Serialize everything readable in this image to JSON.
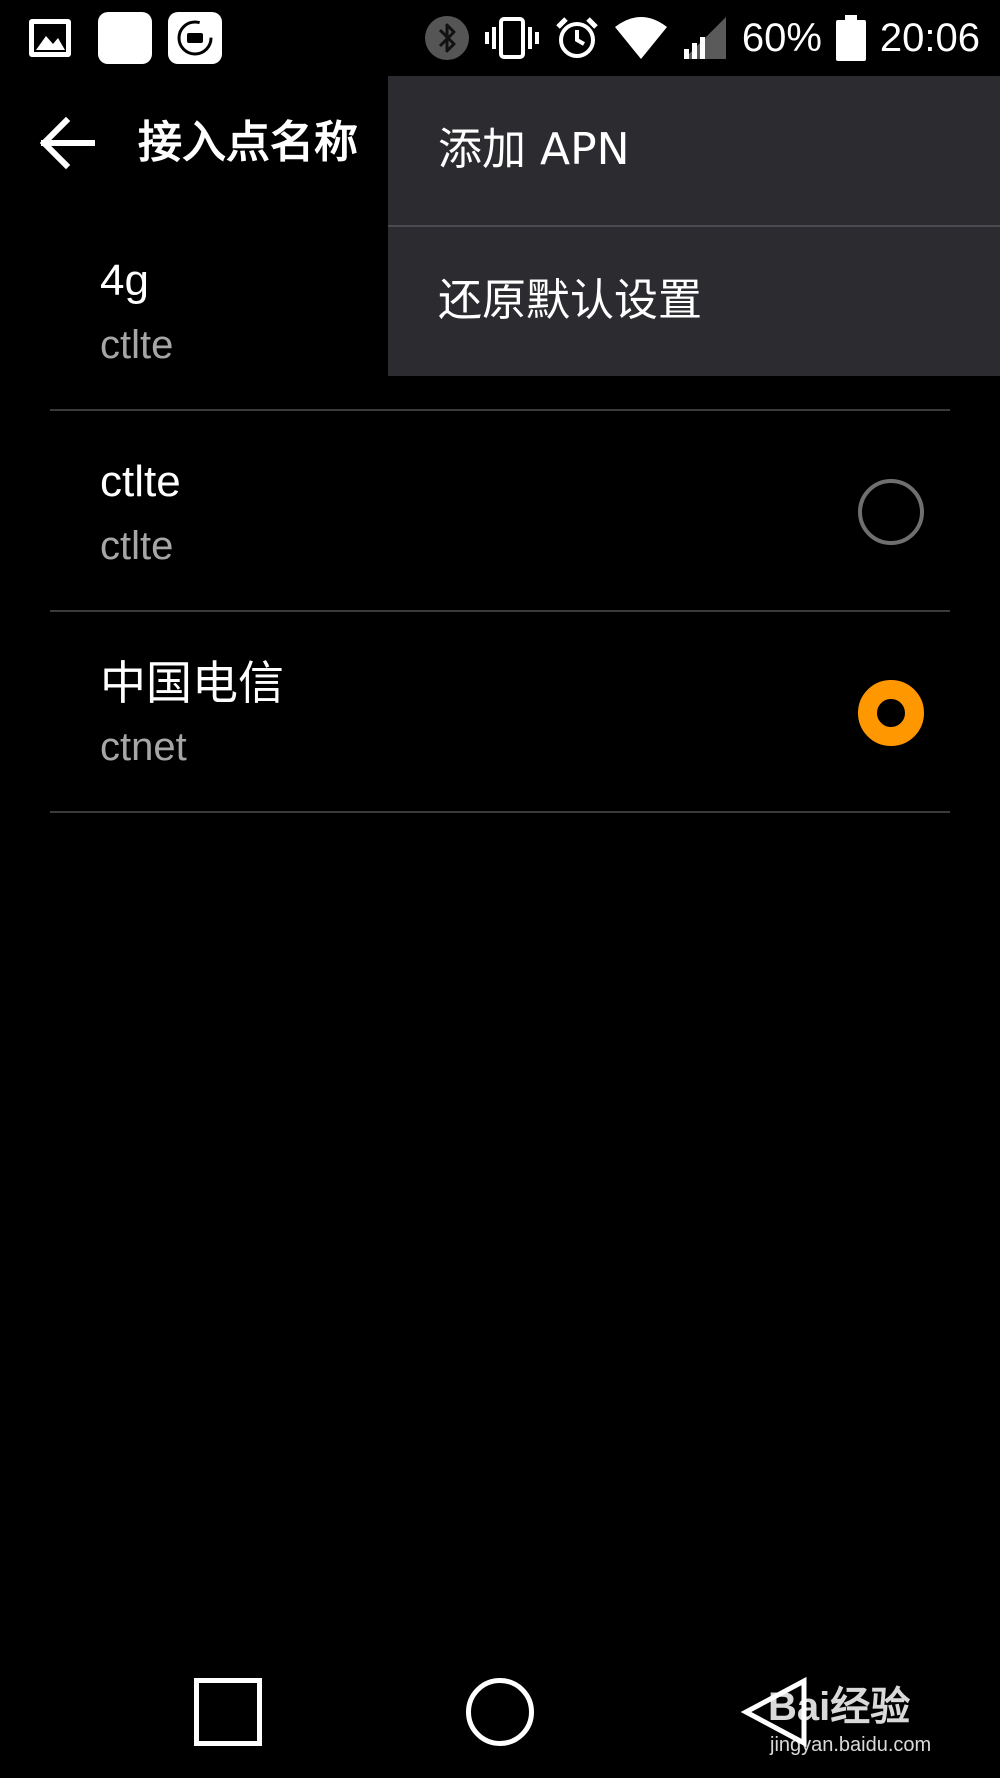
{
  "colors": {
    "background": "#000000",
    "menu_background": "#2c2c30",
    "accent": "#ff9800",
    "secondary_text": "#a6a6a6",
    "divider": "#3a3a3a"
  },
  "status_bar": {
    "left_icons": [
      "gallery-icon",
      "app-icon-blank",
      "mi-app-icon"
    ],
    "right_icons": [
      "bluetooth-icon",
      "vibrate-icon",
      "alarm-icon",
      "wifi-icon",
      "cell-signal-icon",
      "battery-icon"
    ],
    "battery_percent": "60%",
    "time": "20:06"
  },
  "app_bar": {
    "title": "接入点名称"
  },
  "apn_list": [
    {
      "name": "4g",
      "apn": "ctlte",
      "selected": false
    },
    {
      "name": "ctlte",
      "apn": "ctlte",
      "selected": false
    },
    {
      "name": "中国电信",
      "apn": "ctnet",
      "selected": true
    }
  ],
  "overflow_menu": {
    "items": [
      {
        "label": "添加 APN"
      },
      {
        "label": "还原默认设置"
      }
    ]
  },
  "nav_bar": {
    "buttons": [
      "recents-button",
      "home-button",
      "back-button"
    ]
  },
  "watermark": {
    "text": "Bai经验",
    "url": "jingyan.baidu.com"
  }
}
